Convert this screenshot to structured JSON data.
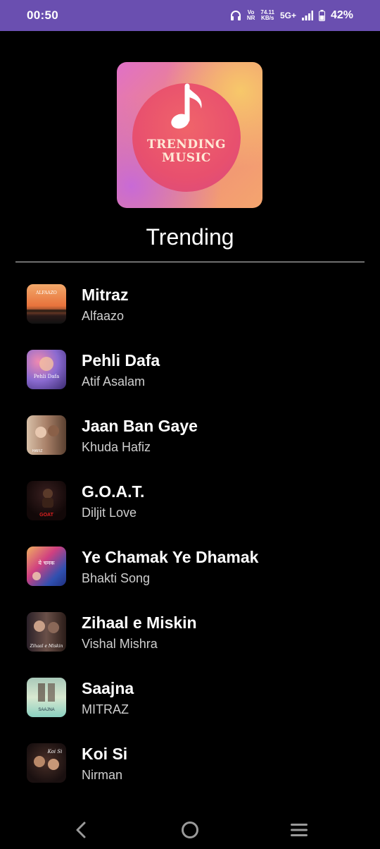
{
  "status": {
    "time": "00:50",
    "vo_top": "Vo",
    "vo_bottom": "NR",
    "speed_top": "74.11",
    "speed_bottom": "KB/s",
    "network": "5G+",
    "battery": "42%"
  },
  "cover": {
    "line1": "TRENDING",
    "line2": "MUSIC"
  },
  "section_title": "Trending",
  "songs": [
    {
      "title": "Mitraz",
      "artist": "Alfaazo"
    },
    {
      "title": "Pehli Dafa",
      "artist": "Atif Asalam"
    },
    {
      "title": "Jaan Ban Gaye",
      "artist": "Khuda Hafiz"
    },
    {
      "title": "G.O.A.T.",
      "artist": "Diljit Love"
    },
    {
      "title": "Ye Chamak Ye Dhamak",
      "artist": "Bhakti Song"
    },
    {
      "title": "Zihaal e Miskin",
      "artist": "Vishal Mishra"
    },
    {
      "title": "Saajna",
      "artist": "MITRAZ"
    },
    {
      "title": "Koi Si",
      "artist": "Nirman"
    }
  ],
  "thumb_labels": {
    "t0": "ALFAAZO",
    "t1": "Pehli Dafa",
    "t2": "HAFIZ",
    "t3": "GOAT",
    "t4": "ये चमक",
    "t5": "Zihaal e Miskin",
    "t6": "SAAJNA",
    "t7": "Koi Si"
  },
  "icons": {
    "headphones": "headphones-icon",
    "signal": "signal-icon",
    "battery": "battery-icon",
    "back": "back-icon",
    "home": "home-icon",
    "menu": "menu-icon"
  }
}
